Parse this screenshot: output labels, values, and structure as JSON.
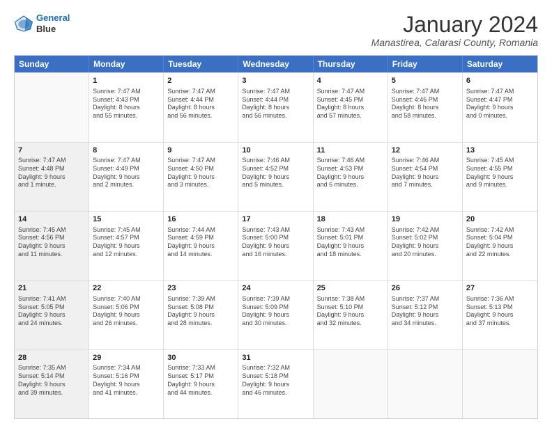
{
  "logo": {
    "line1": "General",
    "line2": "Blue"
  },
  "title": "January 2024",
  "subtitle": "Manastirea, Calarasi County, Romania",
  "header_days": [
    "Sunday",
    "Monday",
    "Tuesday",
    "Wednesday",
    "Thursday",
    "Friday",
    "Saturday"
  ],
  "weeks": [
    [
      {
        "day": "",
        "lines": [],
        "shaded": true
      },
      {
        "day": "1",
        "lines": [
          "Sunrise: 7:47 AM",
          "Sunset: 4:43 PM",
          "Daylight: 8 hours",
          "and 55 minutes."
        ]
      },
      {
        "day": "2",
        "lines": [
          "Sunrise: 7:47 AM",
          "Sunset: 4:44 PM",
          "Daylight: 8 hours",
          "and 56 minutes."
        ]
      },
      {
        "day": "3",
        "lines": [
          "Sunrise: 7:47 AM",
          "Sunset: 4:44 PM",
          "Daylight: 8 hours",
          "and 56 minutes."
        ]
      },
      {
        "day": "4",
        "lines": [
          "Sunrise: 7:47 AM",
          "Sunset: 4:45 PM",
          "Daylight: 8 hours",
          "and 57 minutes."
        ]
      },
      {
        "day": "5",
        "lines": [
          "Sunrise: 7:47 AM",
          "Sunset: 4:46 PM",
          "Daylight: 8 hours",
          "and 58 minutes."
        ]
      },
      {
        "day": "6",
        "lines": [
          "Sunrise: 7:47 AM",
          "Sunset: 4:47 PM",
          "Daylight: 9 hours",
          "and 0 minutes."
        ]
      }
    ],
    [
      {
        "day": "7",
        "lines": [
          "Sunrise: 7:47 AM",
          "Sunset: 4:48 PM",
          "Daylight: 9 hours",
          "and 1 minute."
        ],
        "shaded": true
      },
      {
        "day": "8",
        "lines": [
          "Sunrise: 7:47 AM",
          "Sunset: 4:49 PM",
          "Daylight: 9 hours",
          "and 2 minutes."
        ]
      },
      {
        "day": "9",
        "lines": [
          "Sunrise: 7:47 AM",
          "Sunset: 4:50 PM",
          "Daylight: 9 hours",
          "and 3 minutes."
        ]
      },
      {
        "day": "10",
        "lines": [
          "Sunrise: 7:46 AM",
          "Sunset: 4:52 PM",
          "Daylight: 9 hours",
          "and 5 minutes."
        ]
      },
      {
        "day": "11",
        "lines": [
          "Sunrise: 7:46 AM",
          "Sunset: 4:53 PM",
          "Daylight: 9 hours",
          "and 6 minutes."
        ]
      },
      {
        "day": "12",
        "lines": [
          "Sunrise: 7:46 AM",
          "Sunset: 4:54 PM",
          "Daylight: 9 hours",
          "and 7 minutes."
        ]
      },
      {
        "day": "13",
        "lines": [
          "Sunrise: 7:45 AM",
          "Sunset: 4:55 PM",
          "Daylight: 9 hours",
          "and 9 minutes."
        ]
      }
    ],
    [
      {
        "day": "14",
        "lines": [
          "Sunrise: 7:45 AM",
          "Sunset: 4:56 PM",
          "Daylight: 9 hours",
          "and 11 minutes."
        ],
        "shaded": true
      },
      {
        "day": "15",
        "lines": [
          "Sunrise: 7:45 AM",
          "Sunset: 4:57 PM",
          "Daylight: 9 hours",
          "and 12 minutes."
        ]
      },
      {
        "day": "16",
        "lines": [
          "Sunrise: 7:44 AM",
          "Sunset: 4:59 PM",
          "Daylight: 9 hours",
          "and 14 minutes."
        ]
      },
      {
        "day": "17",
        "lines": [
          "Sunrise: 7:43 AM",
          "Sunset: 5:00 PM",
          "Daylight: 9 hours",
          "and 16 minutes."
        ]
      },
      {
        "day": "18",
        "lines": [
          "Sunrise: 7:43 AM",
          "Sunset: 5:01 PM",
          "Daylight: 9 hours",
          "and 18 minutes."
        ]
      },
      {
        "day": "19",
        "lines": [
          "Sunrise: 7:42 AM",
          "Sunset: 5:02 PM",
          "Daylight: 9 hours",
          "and 20 minutes."
        ]
      },
      {
        "day": "20",
        "lines": [
          "Sunrise: 7:42 AM",
          "Sunset: 5:04 PM",
          "Daylight: 9 hours",
          "and 22 minutes."
        ]
      }
    ],
    [
      {
        "day": "21",
        "lines": [
          "Sunrise: 7:41 AM",
          "Sunset: 5:05 PM",
          "Daylight: 9 hours",
          "and 24 minutes."
        ],
        "shaded": true
      },
      {
        "day": "22",
        "lines": [
          "Sunrise: 7:40 AM",
          "Sunset: 5:06 PM",
          "Daylight: 9 hours",
          "and 26 minutes."
        ]
      },
      {
        "day": "23",
        "lines": [
          "Sunrise: 7:39 AM",
          "Sunset: 5:08 PM",
          "Daylight: 9 hours",
          "and 28 minutes."
        ]
      },
      {
        "day": "24",
        "lines": [
          "Sunrise: 7:39 AM",
          "Sunset: 5:09 PM",
          "Daylight: 9 hours",
          "and 30 minutes."
        ]
      },
      {
        "day": "25",
        "lines": [
          "Sunrise: 7:38 AM",
          "Sunset: 5:10 PM",
          "Daylight: 9 hours",
          "and 32 minutes."
        ]
      },
      {
        "day": "26",
        "lines": [
          "Sunrise: 7:37 AM",
          "Sunset: 5:12 PM",
          "Daylight: 9 hours",
          "and 34 minutes."
        ]
      },
      {
        "day": "27",
        "lines": [
          "Sunrise: 7:36 AM",
          "Sunset: 5:13 PM",
          "Daylight: 9 hours",
          "and 37 minutes."
        ]
      }
    ],
    [
      {
        "day": "28",
        "lines": [
          "Sunrise: 7:35 AM",
          "Sunset: 5:14 PM",
          "Daylight: 9 hours",
          "and 39 minutes."
        ],
        "shaded": true
      },
      {
        "day": "29",
        "lines": [
          "Sunrise: 7:34 AM",
          "Sunset: 5:16 PM",
          "Daylight: 9 hours",
          "and 41 minutes."
        ]
      },
      {
        "day": "30",
        "lines": [
          "Sunrise: 7:33 AM",
          "Sunset: 5:17 PM",
          "Daylight: 9 hours",
          "and 44 minutes."
        ]
      },
      {
        "day": "31",
        "lines": [
          "Sunrise: 7:32 AM",
          "Sunset: 5:18 PM",
          "Daylight: 9 hours",
          "and 46 minutes."
        ]
      },
      {
        "day": "",
        "lines": [],
        "shaded": true
      },
      {
        "day": "",
        "lines": [],
        "shaded": true
      },
      {
        "day": "",
        "lines": [],
        "shaded": true
      }
    ]
  ]
}
